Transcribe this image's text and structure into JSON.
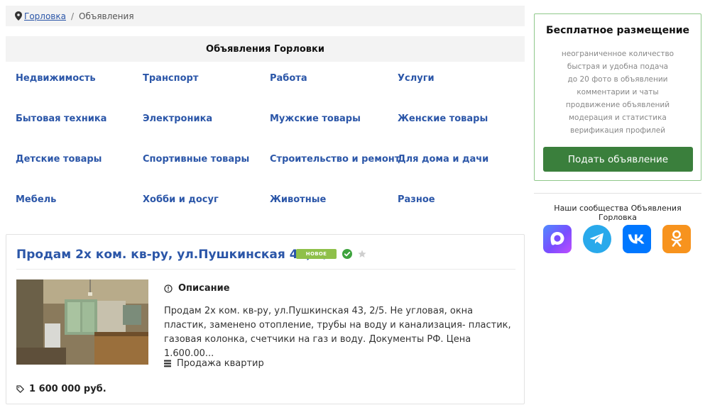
{
  "breadcrumb": {
    "city": "Горловка",
    "current": "Объявления"
  },
  "categories_title": "Объявления Горловки",
  "categories": [
    "Недвижимость",
    "Транспорт",
    "Работа",
    "Услуги",
    "Бытовая техника",
    "Электроника",
    "Мужские товары",
    "Женские товары",
    "Детские товары",
    "Спортивные товары",
    "Строительство и ремонт",
    "Для дома и дачи",
    "Мебель",
    "Хобби и досуг",
    "Животные",
    "Разное"
  ],
  "listing": {
    "title": "Продам 2х ком. кв-ру, ул.Пушкинская 43, 2/5",
    "badge": "НОВОЕ",
    "description_label": "Описание",
    "description": "Продам 2х ком. кв-ру, ул.Пушкинская 43, 2/5. Не угловая, окна пластик, заменено отопление, трубы на воду и канализация- пластик, газовая колонка, счетчики на газ и воду. Документы РФ. Цена 1.600.00...",
    "category": "Продажа квартир",
    "price": "1 600 000 руб."
  },
  "sidebar": {
    "title": "Бесплатное размещение",
    "features": [
      "неограниченное количество",
      "быстрая и удобна подача",
      "до 20 фото в объявлении",
      "комментарии и чаты",
      "продвижение объявлений",
      "модерация и статистика",
      "верификация профилей"
    ],
    "button_label": "Подать объявление",
    "communities_label": "Наши сообщества Объявления Горловка",
    "socials": [
      "max-icon",
      "telegram-icon",
      "vk-icon",
      "odnoklassniki-icon"
    ]
  },
  "colors": {
    "link": "#2b56a8",
    "button": "#3a7f3c",
    "badge": "#8fc04a",
    "telegram": "#29a9eb",
    "vk": "#0077ff",
    "ok": "#f7931e"
  }
}
